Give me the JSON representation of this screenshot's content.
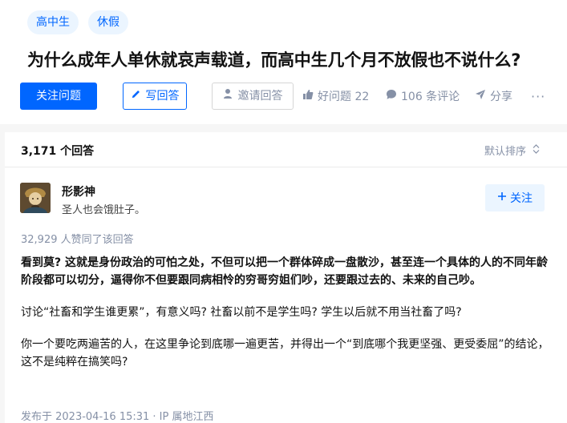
{
  "question": {
    "topics": [
      "高中生",
      "休假"
    ],
    "title": "为什么成年人单休就哀声载道，而高中生几个月不放假也不说什么?"
  },
  "actions": {
    "follow_question": "关注问题",
    "write_answer": "写回答",
    "invite_answer": "邀请回答",
    "good_question": "好问题 22",
    "comments": "106 条评论",
    "share": "分享",
    "more": "···"
  },
  "answers": {
    "count": "3,171 个回答",
    "sort": "默认排序"
  },
  "answer": {
    "author_name": "形影神",
    "author_bio": "圣人也会饿肚子。",
    "follow_author": "关注",
    "vote_info": "32,929 人赞同了该回答",
    "paragraphs": [
      "看到莫? 这就是身份政治的可怕之处，不但可以把一个群体碎成一盘散沙，甚至连一个具体的人的不同年龄阶段都可以切分，逼得你不但要跟同病相怜的穷哥穷姐们吵，还要跟过去的、未来的自己吵。",
      "讨论“社畜和学生谁更累”，有意义吗? 社畜以前不是学生吗? 学生以后就不用当社畜了吗?",
      "你一个要吃两遍苦的人，在这里争论到底哪一遍更苦，并得出一个“到底哪个我更坚强、更受委屈”的结论，这不是纯粹在搞笑吗?"
    ],
    "published": "发布于 2023-04-16 15:31 · IP 属地江西"
  },
  "colors": {
    "accent": "#0066ff",
    "tag_bg": "#ebf5ff",
    "muted": "#8590a6"
  },
  "icons": [
    "pencil-icon",
    "invite-icon",
    "thumb-up-icon",
    "comment-icon",
    "share-icon",
    "more-icon",
    "sort-icon",
    "plus-icon",
    "avatar-image"
  ]
}
